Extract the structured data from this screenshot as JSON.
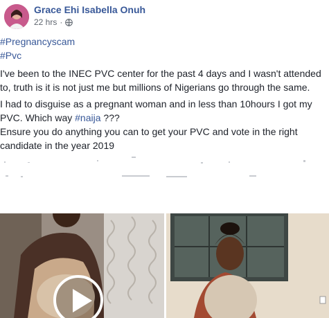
{
  "post": {
    "author": "Grace Ehi Isabella Onuh",
    "time": "22 hrs",
    "separator": "·",
    "privacy_icon": "globe-icon",
    "hashtags": [
      "#Pregnancyscam",
      "#Pvc"
    ],
    "paragraph1": "I've been to the INEC PVC center for the past 4 days and I wasn't attended to, truth is it is not just me but millions of Nigerians go through the same.",
    "paragraph2_before_tag": "I had to disguise as a pregnant woman and in less than 10hours I got my PVC. Which way ",
    "paragraph2_tag": "#naija",
    "paragraph2_after_tag": " ???",
    "paragraph3": "Ensure you do anything you can to get your PVC and vote in the right candidate in the year 2019"
  },
  "media": {
    "video_play_icon": "play-icon",
    "photo_count": 2
  },
  "colors": {
    "link": "#385898",
    "text": "#1d2129",
    "meta": "#606770"
  }
}
